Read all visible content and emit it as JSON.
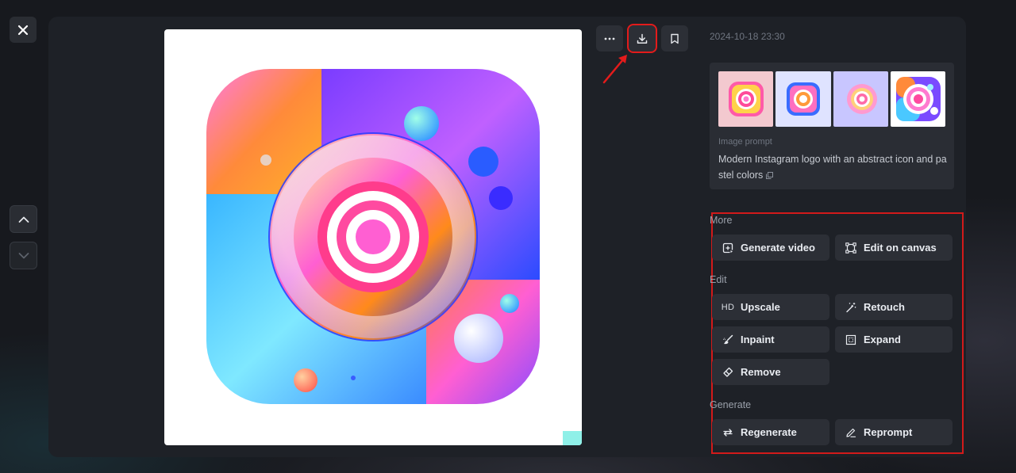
{
  "window": {
    "close_label": "Close",
    "nav_up_label": "Previous",
    "nav_down_label": "Next"
  },
  "image": {
    "alt": "Modern Instagram logo with an abstract icon and pastel colors"
  },
  "toolbar": {
    "more_label": "More options",
    "download_label": "Download",
    "bookmark_label": "Bookmark"
  },
  "details": {
    "timestamp": "2024-10-18 23:30",
    "prompt_label": "Image prompt",
    "prompt_text": "Modern Instagram logo with an abstract icon and pastel colors",
    "thumbnails": [
      {
        "name": "variant-1",
        "selected": false
      },
      {
        "name": "variant-2",
        "selected": false
      },
      {
        "name": "variant-3",
        "selected": false
      },
      {
        "name": "variant-4",
        "selected": true
      }
    ]
  },
  "sections": {
    "more": {
      "label": "More",
      "actions": [
        {
          "label": "Generate video",
          "icon": "video-plus-icon"
        },
        {
          "label": "Edit on canvas",
          "icon": "canvas-frame-icon"
        }
      ]
    },
    "edit": {
      "label": "Edit",
      "actions": [
        {
          "label": "Upscale",
          "icon": "hd-icon",
          "icon_text": "HD"
        },
        {
          "label": "Retouch",
          "icon": "magic-wand-icon"
        },
        {
          "label": "Inpaint",
          "icon": "brush-icon"
        },
        {
          "label": "Expand",
          "icon": "expand-icon"
        },
        {
          "label": "Remove",
          "icon": "eraser-icon"
        }
      ]
    },
    "generate": {
      "label": "Generate",
      "actions": [
        {
          "label": "Regenerate",
          "icon": "refresh-icon"
        },
        {
          "label": "Reprompt",
          "icon": "pencil-icon"
        }
      ]
    }
  },
  "annotations": {
    "highlight_color": "#e31b1b"
  }
}
